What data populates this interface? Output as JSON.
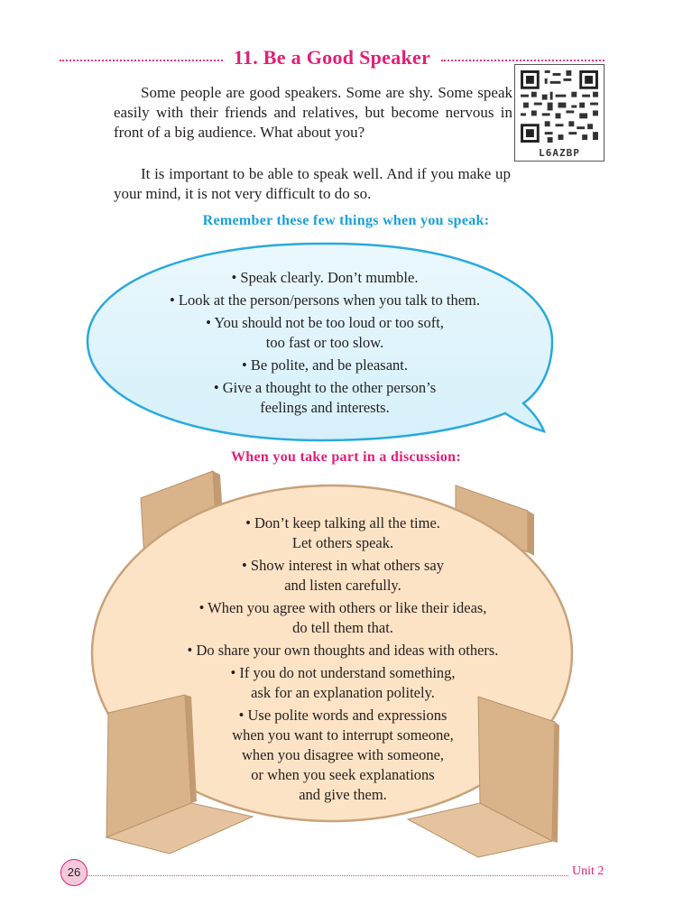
{
  "title": "11.  Be a  Good  Speaker",
  "qr": {
    "code_label": "L6AZBP"
  },
  "intro": {
    "p1": "Some people are good speakers. Some are shy. Some speak easily with their friends and relatives, but become nervous in front of a big audience. What about you?",
    "p2": "It is important to be able to speak well. And if you make up your mind, it is not very difficult to do so."
  },
  "speak_section": {
    "heading": "Remember these few things when you speak:",
    "items": [
      [
        "• Speak clearly. Don’t mumble."
      ],
      [
        "• Look at the person/persons when you talk to them."
      ],
      [
        "• You should not be too loud or too soft,",
        "too fast or too slow."
      ],
      [
        "• Be polite, and be pleasant."
      ],
      [
        "• Give a thought to the other person’s",
        "feelings and interests."
      ]
    ]
  },
  "discussion_section": {
    "heading": "When you take part in a discussion:",
    "items": [
      [
        "• Don’t keep talking all the time.",
        "Let others speak."
      ],
      [
        "• Show interest in what others say",
        "and listen carefully."
      ],
      [
        "• When you agree with others or like their ideas,",
        "do tell them that."
      ],
      [
        "• Do share your own thoughts and ideas with others."
      ],
      [
        "• If you do not understand something,",
        "ask for an explanation politely."
      ],
      [
        "• Use polite words and expressions",
        "when you want to interrupt someone,",
        "when you disagree with someone,",
        "or when you seek explanations",
        "and give them."
      ]
    ]
  },
  "footer": {
    "page_number": "26",
    "unit": "Unit 2"
  },
  "colors": {
    "accent_pink": "#e21f76",
    "accent_blue": "#1ba0d8",
    "table_fill": "#fde3c5",
    "chair_fill": "#d9b48a"
  }
}
